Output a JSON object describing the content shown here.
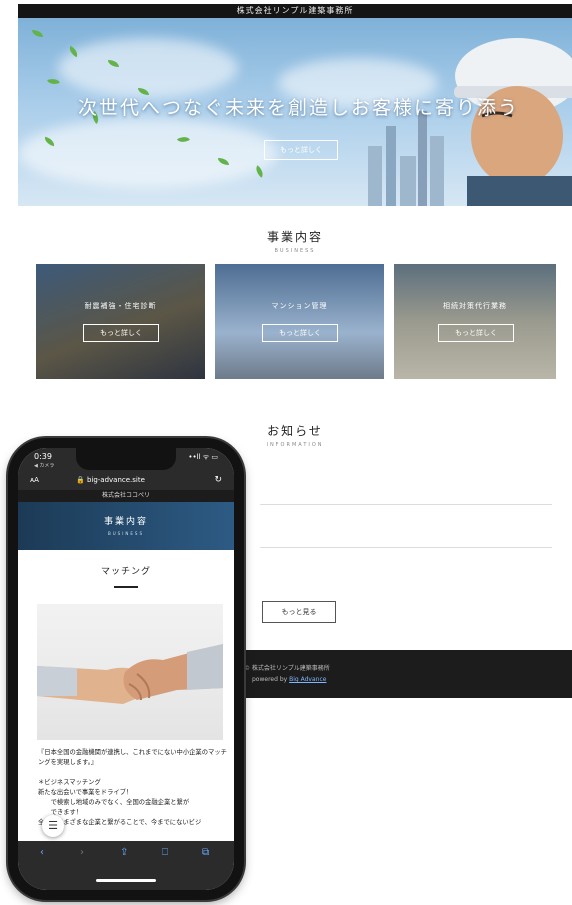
{
  "desktop": {
    "top_bar": "株式会社リンプル建築事務所",
    "hero_title": "次世代へつなぐ未来を創造しお客様に寄り添う",
    "hero_button": "もっと詳しく",
    "business_title": "事業内容",
    "business_sub": "BUSINESS",
    "cards": [
      {
        "label": "耐震補強・住宅診断",
        "button": "もっと詳しく"
      },
      {
        "label": "マンション管理",
        "button": "もっと詳しく"
      },
      {
        "label": "相続対策代行業務",
        "button": "もっと詳しく"
      }
    ],
    "info_title": "お知らせ",
    "info_sub": "INFORMATION",
    "more_button": "もっと見る",
    "footer_copy": "© 株式会社リンプル建築事務所",
    "footer_powered_prefix": "powered by",
    "footer_powered_link": "Big Advance"
  },
  "phone": {
    "time": "0:39",
    "camera_label": "◀ カメラ",
    "status_icons": "••ll ᯤ ▭",
    "aa": "ᴀA",
    "url": "🔒 big-advance.site",
    "reload": "↻",
    "site_header": "株式会社ココペリ",
    "section_title": "事業内容",
    "section_sub": "BUSINESS",
    "heading": "マッチング",
    "paragraphs": [
      "『日本全国の金融機関が連携し、これまでにない中小企業のマッチングを実現します。』",
      "",
      "＊ビジネスマッチング",
      "新たな出会いで事業をドライブ！",
      "　　で検索し地域のみでなく、全国の金融企業と繋が",
      "　　できます！",
      "全国のさまざまな企業と繋がることで、今までにないビジ"
    ],
    "menu_icon": "☰",
    "toolbar": [
      "‹",
      "›",
      "⇪",
      "⎕",
      "⧉"
    ]
  }
}
